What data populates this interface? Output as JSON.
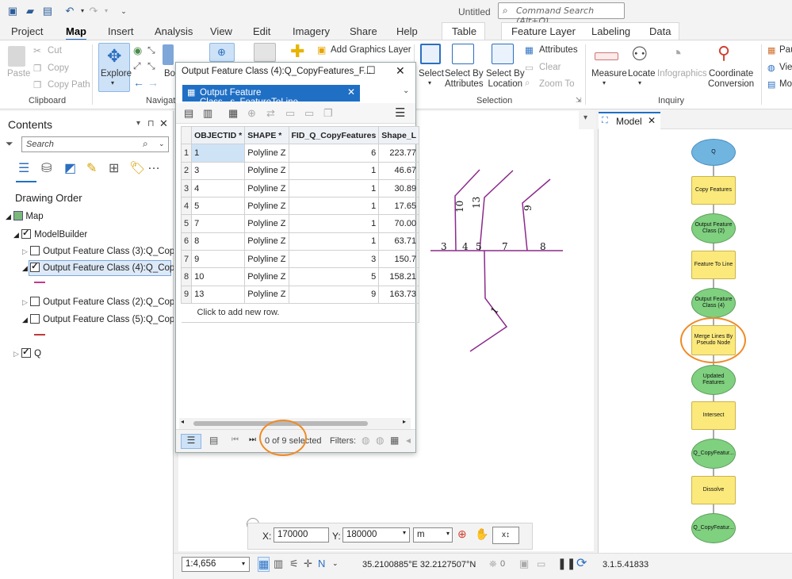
{
  "app": {
    "document_title": "Untitled",
    "command_search_placeholder": "Command Search (Alt+Q)"
  },
  "ribbon_tabs": [
    "Project",
    "Map",
    "Insert",
    "Analysis",
    "View",
    "Edit",
    "Imagery",
    "Share",
    "Help",
    "Table",
    "Feature Layer",
    "Labeling",
    "Data"
  ],
  "ribbon": {
    "clipboard": {
      "paste": "Paste",
      "cut": "Cut",
      "copy": "Copy",
      "copy_path": "Copy Path",
      "group": "Clipboard"
    },
    "navigate": {
      "explore": "Explore",
      "bookmarks": "Bo",
      "group": "Navigate"
    },
    "layer": {
      "add_graphics_layer": "Add Graphics Layer"
    },
    "selection": {
      "select": "Select",
      "select_by_attributes": "Select By\nAttributes",
      "select_by_location": "Select By\nLocation",
      "attributes": "Attributes",
      "clear": "Clear",
      "zoom_to": "Zoom To",
      "group": "Selection"
    },
    "inquiry": {
      "measure": "Measure",
      "locate": "Locate",
      "infographics": "Infographics",
      "coordinate_conversion": "Coordinate\nConversion",
      "group": "Inquiry"
    },
    "extra": [
      "Pau",
      "Vie",
      "Mo"
    ]
  },
  "contents": {
    "title": "Contents",
    "search_placeholder": "Search",
    "drawing_order": "Drawing Order",
    "map": "Map",
    "group": "ModelBuilder",
    "layers": [
      {
        "label": "Output Feature Class (3):Q_Cop...",
        "checked": false
      },
      {
        "label": "Output Feature Class (4):Q_Cop...",
        "checked": true
      },
      {
        "label": "Output Feature Class (2):Q_Cop...",
        "checked": false
      },
      {
        "label": "Output Feature Class (5):Q_Cop...",
        "checked": false
      }
    ],
    "q_layer": "Q"
  },
  "table_window": {
    "title": "Output Feature Class (4):Q_CopyFeatures_F...",
    "tab": "Output Feature Class...s_FeatureToLine",
    "columns": [
      "OBJECTID *",
      "SHAPE *",
      "FID_Q_CopyFeatures",
      "Shape_L"
    ],
    "rows": [
      {
        "n": "1",
        "oid": "1",
        "shape": "Polyline Z",
        "fid": "6",
        "len": "223.77"
      },
      {
        "n": "2",
        "oid": "3",
        "shape": "Polyline Z",
        "fid": "1",
        "len": "46.67"
      },
      {
        "n": "3",
        "oid": "4",
        "shape": "Polyline Z",
        "fid": "1",
        "len": "30.89"
      },
      {
        "n": "4",
        "oid": "5",
        "shape": "Polyline Z",
        "fid": "1",
        "len": "17.65"
      },
      {
        "n": "5",
        "oid": "7",
        "shape": "Polyline Z",
        "fid": "1",
        "len": "70.00"
      },
      {
        "n": "6",
        "oid": "8",
        "shape": "Polyline Z",
        "fid": "1",
        "len": "63.71"
      },
      {
        "n": "7",
        "oid": "9",
        "shape": "Polyline Z",
        "fid": "3",
        "len": "150.7"
      },
      {
        "n": "8",
        "oid": "10",
        "shape": "Polyline Z",
        "fid": "5",
        "len": "158.21"
      },
      {
        "n": "9",
        "oid": "13",
        "shape": "Polyline Z",
        "fid": "9",
        "len": "163.73"
      }
    ],
    "add_row": "Click to add new row.",
    "selected": "0 of 9 selected",
    "filters": "Filters:"
  },
  "map_labels": [
    "3",
    "4",
    "5",
    "7",
    "8",
    "10",
    "13",
    "9",
    "1"
  ],
  "model": {
    "tab": "Model",
    "nodes": [
      "Q",
      "Copy Features",
      "Output Feature Class (2)",
      "Feature To Line",
      "Output Feature Class (4)",
      "Merge Lines By Pseudo Node",
      "Updated Features",
      "Intersect",
      "Q_CopyFeatur...",
      "Dissolve",
      "Q_CopyFeatur..."
    ],
    "version": "3.1.5.41833"
  },
  "coords": {
    "x_label": "X:",
    "x": "170000",
    "y_label": "Y:",
    "y": "180000",
    "unit": "m"
  },
  "status": {
    "scale": "1:4,656",
    "location": "35.2100885°E 32.2127507°N",
    "count": "0"
  },
  "colors": {
    "accent": "#1f6fc5",
    "feature": "#8b2a8b",
    "highlight": "#f08a24",
    "data_node": "#7fd07f",
    "tool_node": "#fbe97c",
    "input_node": "#6fb5e0"
  }
}
